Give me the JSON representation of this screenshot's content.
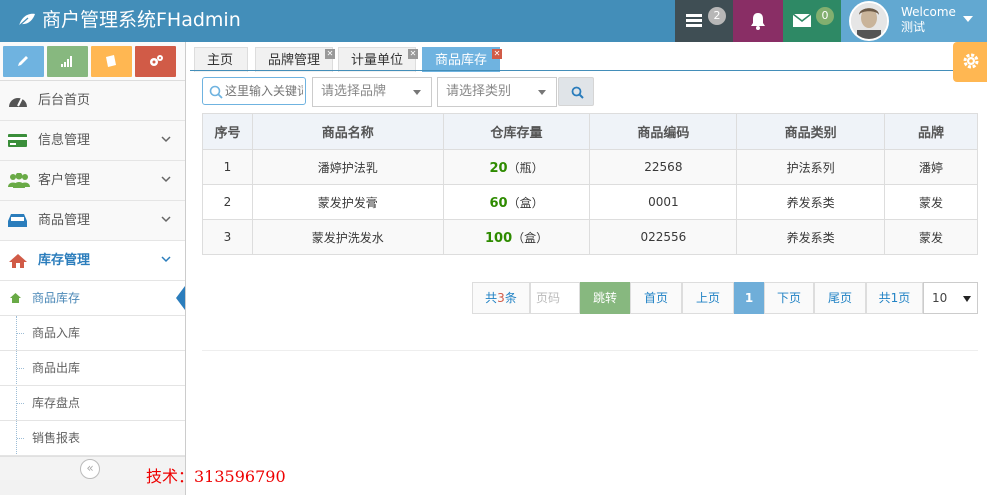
{
  "header": {
    "brand": "商户管理系统FHadmin",
    "tasks_badge": "2",
    "mail_badge": "0",
    "welcome": "Welcome",
    "username": "测试"
  },
  "sidebar": {
    "menu": [
      {
        "label": "后台首页",
        "icon": "dashboard-icon"
      },
      {
        "label": "信息管理",
        "icon": "credit-card-icon"
      },
      {
        "label": "客户管理",
        "icon": "users-icon"
      },
      {
        "label": "商品管理",
        "icon": "inbox-icon"
      },
      {
        "label": "库存管理",
        "icon": "home-icon"
      }
    ],
    "submenu": [
      "商品库存",
      "商品入库",
      "商品出库",
      "库存盘点",
      "销售报表"
    ],
    "collapse_label": "«"
  },
  "tech_note": "技术：313596790",
  "tabs": [
    "主页",
    "品牌管理",
    "计量单位",
    "商品库存"
  ],
  "filters": {
    "search_placeholder": "这里输入关键词",
    "brand_select": "请选择品牌",
    "category_select": "请选择类别"
  },
  "table": {
    "headers": [
      "序号",
      "商品名称",
      "仓库存量",
      "商品编码",
      "商品类别",
      "品牌"
    ],
    "rows": [
      {
        "no": "1",
        "name": "潘婷护法乳",
        "qty": "20",
        "unit": "（瓶）",
        "code": "22568",
        "category": "护法系列",
        "brand": "潘婷"
      },
      {
        "no": "2",
        "name": "蒙发护发膏",
        "qty": "60",
        "unit": "（盒）",
        "code": "0001",
        "category": "养发系类",
        "brand": "蒙发"
      },
      {
        "no": "3",
        "name": "蒙发护洗发水",
        "qty": "100",
        "unit": "（盒）",
        "code": "022556",
        "category": "养发系类",
        "brand": "蒙发"
      }
    ]
  },
  "pager": {
    "total_prefix": "共",
    "total_count": "3",
    "total_suffix": "条",
    "page_placeholder": "页码",
    "jump": "跳转",
    "first": "首页",
    "prev": "上页",
    "current": "1",
    "next": "下页",
    "last": "尾页",
    "pages": "共1页",
    "page_size": "10"
  },
  "colors": {
    "topbar": "#438eb9",
    "active_tab": "#6fb3e0",
    "qty_green": "#2e8b00",
    "tech_red": "#e00000"
  }
}
